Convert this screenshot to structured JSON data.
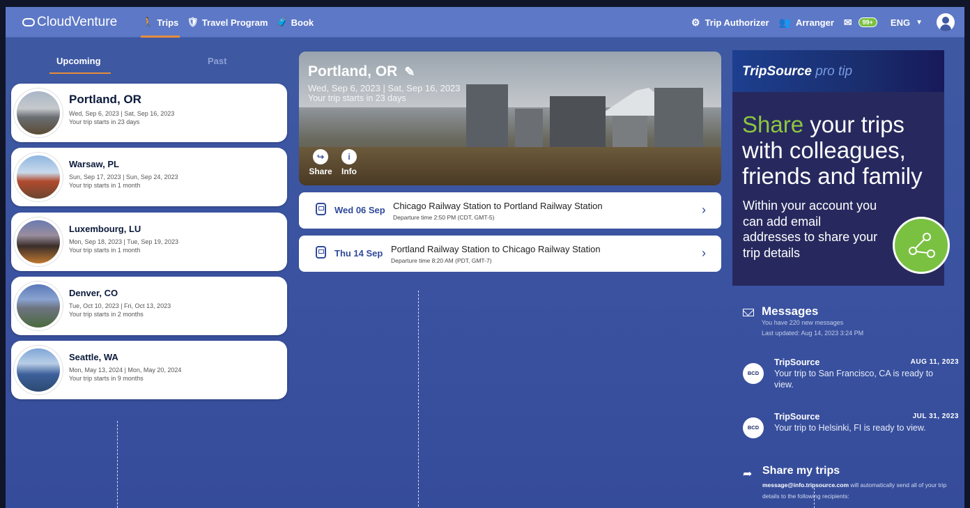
{
  "nav": {
    "brand": "CloudVenture",
    "links": [
      {
        "label": "Trips",
        "icon": "walking-icon"
      },
      {
        "label": "Travel Program",
        "icon": "shield-icon"
      },
      {
        "label": "Book",
        "icon": "luggage-icon"
      }
    ],
    "right": {
      "trip_authorizer": "Trip Authorizer",
      "arranger": "Arranger",
      "badge_count": "99+",
      "language": "ENG"
    }
  },
  "tabs": {
    "upcoming": "Upcoming",
    "past": "Past"
  },
  "trips": [
    {
      "city": "Portland, OR",
      "dates": "Wed, Sep 6, 2023 | Sat, Sep 16, 2023",
      "starts": "Your trip starts in 23 days"
    },
    {
      "city": "Warsaw, PL",
      "dates": "Sun, Sep 17, 2023 | Sun, Sep 24, 2023",
      "starts": "Your trip starts in 1 month"
    },
    {
      "city": "Luxembourg, LU",
      "dates": "Mon, Sep 18, 2023 | Tue, Sep 19, 2023",
      "starts": "Your trip starts in 1 month"
    },
    {
      "city": "Denver, CO",
      "dates": "Tue, Oct 10, 2023 | Fri, Oct 13, 2023",
      "starts": "Your trip starts in 2 months"
    },
    {
      "city": "Seattle, WA",
      "dates": "Mon, May 13, 2024 | Mon, May 20, 2024",
      "starts": "Your trip starts in 9 months"
    }
  ],
  "hero": {
    "city": "Portland, OR",
    "dates": "Wed, Sep 6, 2023 | Sat, Sep 16, 2023",
    "starts": "Your trip starts in 23 days",
    "share": "Share",
    "info": "Info"
  },
  "segments": [
    {
      "date": "Wed 06 Sep",
      "route": "Chicago Railway Station to Portland Railway Station",
      "departure": "Departure time 2:50 PM (CDT, GMT-5)"
    },
    {
      "date": "Thu 14 Sep",
      "route": "Portland Railway Station to Chicago Railway Station",
      "departure": "Departure time 8:20 AM (PDT, GMT-7)"
    }
  ],
  "protip": {
    "brand": "TripSource",
    "tag": "pro tip",
    "headline_green": "Share",
    "headline_rest": " your trips with colleagues, friends and family",
    "body": "Within your account you can add email addresses to share your trip details"
  },
  "messages": {
    "title": "Messages",
    "count_text": "You have 220 new messages",
    "updated": "Last updated: Aug 14, 2023 3:24 PM",
    "items": [
      {
        "from": "TripSource",
        "date": "AUG 11, 2023",
        "text": "Your trip to San Francisco, CA is ready to view.",
        "logo": "BCD"
      },
      {
        "from": "TripSource",
        "date": "JUL 31, 2023",
        "text": "Your trip to Helsinki, FI is ready to view.",
        "logo": "BCD"
      }
    ]
  },
  "share_my_trips": {
    "title": "Share my trips",
    "email": "message@info.tripsource.com",
    "text": " will automatically send all of your trip details to the following recipients:"
  },
  "colors": {
    "accent": "#e58d3c",
    "green": "#7ac142",
    "nav": "#5d78c6",
    "bg": "#3a52a0"
  }
}
